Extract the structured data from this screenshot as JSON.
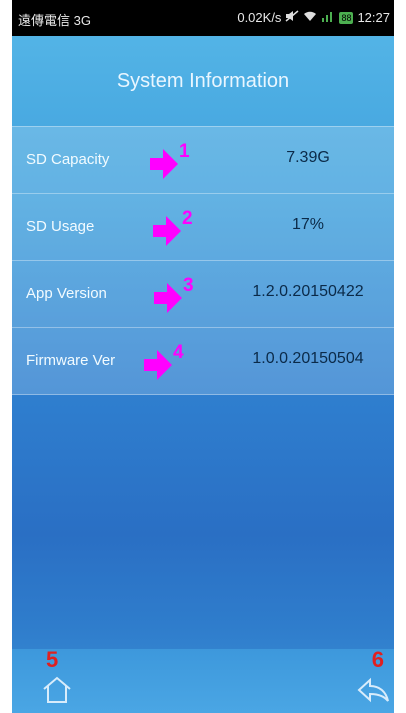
{
  "status_bar": {
    "carrier": "遠傳電信 3G",
    "speed": "0.02K/s",
    "battery": "88",
    "time": "12:27"
  },
  "header": {
    "title": "System Information"
  },
  "rows": [
    {
      "label": "SD Capacity",
      "value": "7.39G",
      "marker": "1"
    },
    {
      "label": "SD Usage",
      "value": "17%",
      "marker": "2"
    },
    {
      "label": "App Version",
      "value": "1.2.0.20150422",
      "marker": "3"
    },
    {
      "label": "Firmware Ver",
      "value": "1.0.0.20150504",
      "marker": "4"
    }
  ],
  "callouts": {
    "home": "5",
    "back": "6"
  },
  "nav": {
    "home_icon": "home-icon",
    "back_icon": "back-icon"
  },
  "colors": {
    "marker": "#ff00ff",
    "callout": "#e02020",
    "header_text": "#e9f6ff"
  }
}
